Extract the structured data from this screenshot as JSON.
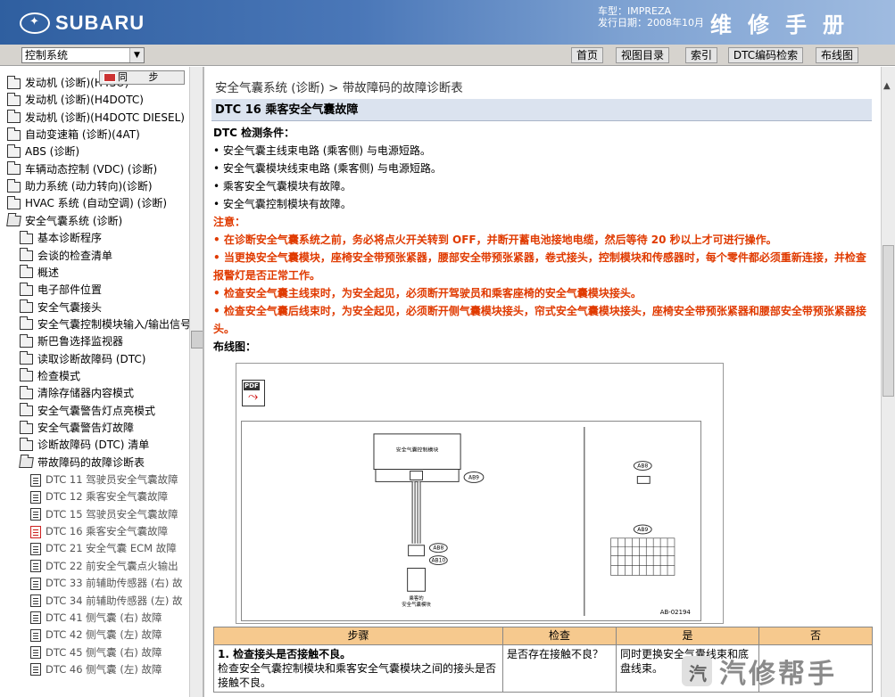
{
  "header": {
    "logo_text": "SUBARU",
    "car_type": "车型：IMPREZA",
    "issue_date": "发行日期：2008年10月",
    "manual_title": "维修手册"
  },
  "toolbar": {
    "system_select_value": "控制系统",
    "buttons": [
      "首页",
      "视图目录",
      "索引",
      "DTC编码检索",
      "布线图"
    ]
  },
  "tree": {
    "sync_label": "同 步",
    "items": [
      {
        "label": "发动机 (诊断)(H4SO)",
        "icon": "folder-icon"
      },
      {
        "label": "发动机 (诊断)(H4DOTC)",
        "icon": "folder-icon"
      },
      {
        "label": "发动机 (诊断)(H4DOTC DIESEL)",
        "icon": "folder-icon"
      },
      {
        "label": "自动变速箱 (诊断)(4AT)",
        "icon": "folder-icon"
      },
      {
        "label": "ABS (诊断)",
        "icon": "folder-icon"
      },
      {
        "label": "车辆动态控制 (VDC) (诊断)",
        "icon": "folder-icon"
      },
      {
        "label": "助力系统 (动力转向)(诊断)",
        "icon": "folder-icon"
      },
      {
        "label": "HVAC 系统 (自动空调) (诊断)",
        "icon": "folder-icon"
      },
      {
        "label": "安全气囊系统 (诊断)",
        "icon": "folder-open-icon"
      },
      {
        "label": "基本诊断程序",
        "icon": "folder-icon"
      },
      {
        "label": "会谈的检查清单",
        "icon": "folder-icon"
      },
      {
        "label": "概述",
        "icon": "folder-icon"
      },
      {
        "label": "电子部件位置",
        "icon": "folder-icon"
      },
      {
        "label": "安全气囊接头",
        "icon": "folder-icon"
      },
      {
        "label": "安全气囊控制模块输入/输出信号",
        "icon": "folder-icon"
      },
      {
        "label": "斯巴鲁选择监视器",
        "icon": "folder-icon"
      },
      {
        "label": "读取诊断故障码 (DTC)",
        "icon": "folder-icon"
      },
      {
        "label": "检查模式",
        "icon": "folder-icon"
      },
      {
        "label": "清除存储器内容模式",
        "icon": "folder-icon"
      },
      {
        "label": "安全气囊警告灯点亮模式",
        "icon": "folder-icon"
      },
      {
        "label": "安全气囊警告灯故障",
        "icon": "folder-icon"
      },
      {
        "label": "诊断故障码 (DTC) 清单",
        "icon": "folder-icon"
      },
      {
        "label": "带故障码的故障诊断表",
        "icon": "folder-open-icon"
      },
      {
        "label": "DTC 11 驾驶员安全气囊故障",
        "icon": "document-icon"
      },
      {
        "label": "DTC 12 乘客安全气囊故障",
        "icon": "document-icon"
      },
      {
        "label": "DTC 15 驾驶员安全气囊故障",
        "icon": "document-icon"
      },
      {
        "label": "DTC 16 乘客安全气囊故障",
        "icon": "document-active-icon"
      },
      {
        "label": "DTC 21 安全气囊 ECM 故障",
        "icon": "document-icon"
      },
      {
        "label": "DTC 22 前安全气囊点火输出",
        "icon": "document-icon"
      },
      {
        "label": "DTC 33 前辅助传感器 (右) 故",
        "icon": "document-icon"
      },
      {
        "label": "DTC 34 前辅助传感器 (左) 故",
        "icon": "document-icon"
      },
      {
        "label": "DTC 41 侧气囊 (右) 故障",
        "icon": "document-icon"
      },
      {
        "label": "DTC 42 侧气囊 (左) 故障",
        "icon": "document-icon"
      },
      {
        "label": "DTC 45 侧气囊 (右) 故障",
        "icon": "document-icon"
      },
      {
        "label": "DTC 46 侧气囊 (左) 故障",
        "icon": "document-icon"
      }
    ]
  },
  "main": {
    "breadcrumb": "安全气囊系统 (诊断) > 带故障码的故障诊断表",
    "dtc_title": "DTC 16 乘客安全气囊故障",
    "detect_heading": "DTC 检测条件：",
    "detect_items": [
      "• 安全气囊主线束电路 (乘客侧) 与电源短路。",
      "• 安全气囊模块线束电路 (乘客侧) 与电源短路。",
      "• 乘客安全气囊模块有故障。",
      "• 安全气囊控制模块有故障。"
    ],
    "note_heading": "注意：",
    "note_items": [
      "• 在诊断安全气囊系统之前，务必将点火开关转到 OFF，并断开蓄电池接地电缆，然后等待 20 秒以上才可进行操作。",
      "• 当更换安全气囊模块，座椅安全带预张紧器，腰部安全带预张紧器，卷式接头，控制模块和传感器时，每个零件都必须重新连接，并检查报警灯是否正常工作。",
      "• 检查安全气囊主线束时，为安全起见，必须断开驾驶员和乘客座椅的安全气囊模块接头。",
      "• 检查安全气囊后线束时，为安全起见，必须断开侧气囊模块接头，帘式安全气囊模块接头，座椅安全带预张紧器和腰部安全带预张紧器接头。"
    ],
    "wiring_heading": "布线图：",
    "diagram": {
      "pdf_tag": "PDF",
      "module_label": "安全气囊控制模块",
      "module_connector": "AB9",
      "pass_connector_a": "AB8",
      "pass_connector_b": "AB10",
      "pass_label_1": "乘客的",
      "pass_label_2": "安全气囊模块",
      "right_top": "AB8",
      "right_bottom": "AB9",
      "figure_id": "AB-02194"
    },
    "table": {
      "headers": [
        "步骤",
        "检查",
        "是",
        "否"
      ],
      "rows": [
        {
          "step_title": "1. 检查接头是否接触不良。",
          "step_desc": "检查安全气囊控制模块和乘客安全气囊模块之间的接头是否接触不良。",
          "check": "是否存在接触不良？",
          "yes": "同时更换安全气囊线束和底盘线束。",
          "no": ""
        }
      ]
    }
  },
  "watermark": {
    "text": "汽修帮手"
  },
  "colors": {
    "header_start": "#2f5fa0",
    "warning": "#e03a00",
    "table_header": "#f6c98e"
  }
}
